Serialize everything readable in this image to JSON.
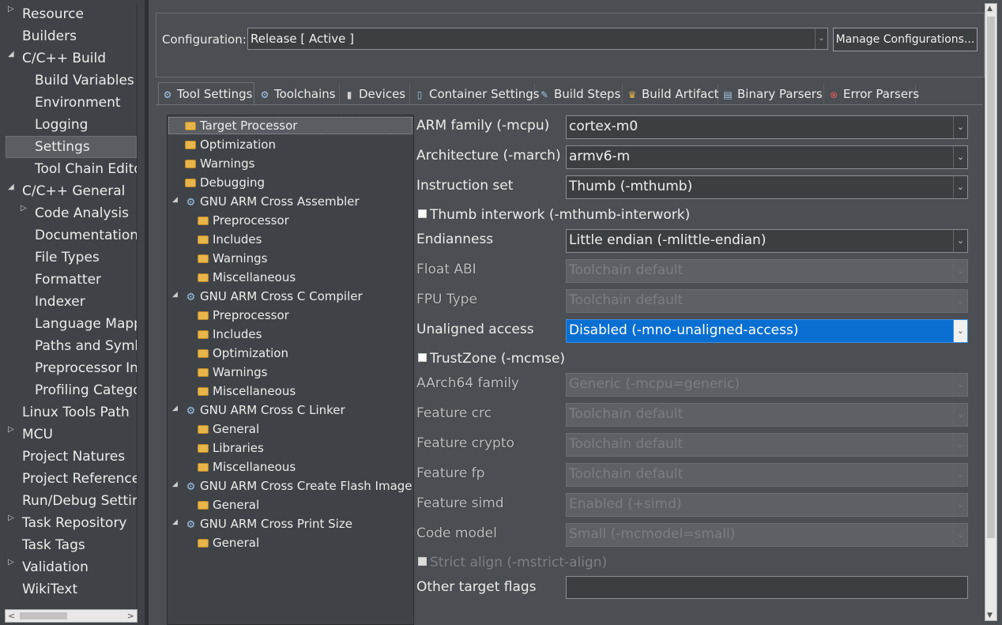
{
  "nav": {
    "items": [
      {
        "label": "Resource",
        "level": 0,
        "twisty": "closed"
      },
      {
        "label": "Builders",
        "level": 0,
        "twisty": "none"
      },
      {
        "label": "C/C++ Build",
        "level": 0,
        "twisty": "open"
      },
      {
        "label": "Build Variables",
        "level": 1,
        "twisty": "none"
      },
      {
        "label": "Environment",
        "level": 1,
        "twisty": "none"
      },
      {
        "label": "Logging",
        "level": 1,
        "twisty": "none"
      },
      {
        "label": "Settings",
        "level": 1,
        "twisty": "none",
        "selected": true
      },
      {
        "label": "Tool Chain Edito",
        "level": 1,
        "twisty": "none"
      },
      {
        "label": "C/C++ General",
        "level": 0,
        "twisty": "open"
      },
      {
        "label": "Code Analysis",
        "level": 1,
        "twisty": "closed"
      },
      {
        "label": "Documentation",
        "level": 1,
        "twisty": "none"
      },
      {
        "label": "File Types",
        "level": 1,
        "twisty": "none"
      },
      {
        "label": "Formatter",
        "level": 1,
        "twisty": "none"
      },
      {
        "label": "Indexer",
        "level": 1,
        "twisty": "none"
      },
      {
        "label": "Language Mapp",
        "level": 1,
        "twisty": "none"
      },
      {
        "label": "Paths and Symb",
        "level": 1,
        "twisty": "none"
      },
      {
        "label": "Preprocessor In",
        "level": 1,
        "twisty": "none"
      },
      {
        "label": "Profiling Catego",
        "level": 1,
        "twisty": "none"
      },
      {
        "label": "Linux Tools Path",
        "level": 0,
        "twisty": "none"
      },
      {
        "label": "MCU",
        "level": 0,
        "twisty": "closed"
      },
      {
        "label": "Project Natures",
        "level": 0,
        "twisty": "none"
      },
      {
        "label": "Project Reference",
        "level": 0,
        "twisty": "none"
      },
      {
        "label": "Run/Debug Settin",
        "level": 0,
        "twisty": "none"
      },
      {
        "label": "Task Repository",
        "level": 0,
        "twisty": "closed"
      },
      {
        "label": "Task Tags",
        "level": 0,
        "twisty": "none"
      },
      {
        "label": "Validation",
        "level": 0,
        "twisty": "closed"
      },
      {
        "label": "WikiText",
        "level": 0,
        "twisty": "none"
      }
    ]
  },
  "config": {
    "label": "Configuration:",
    "value": "Release  [ Active ]",
    "manage_label": "Manage Configurations..."
  },
  "tabs": [
    {
      "label": "Tool Settings",
      "icon": "tool-settings-icon",
      "glyph": "⚙",
      "active": true
    },
    {
      "label": "Toolchains",
      "icon": "toolchains-icon",
      "glyph": "⚙"
    },
    {
      "label": "Devices",
      "icon": "devices-icon",
      "glyph": "▮"
    },
    {
      "label": "Container Settings",
      "icon": "container-icon",
      "glyph": "▯"
    },
    {
      "label": "Build Steps",
      "icon": "build-steps-icon",
      "glyph": "✎"
    },
    {
      "label": "Build Artifact",
      "icon": "trophy-icon",
      "glyph": "♛"
    },
    {
      "label": "Binary Parsers",
      "icon": "binary-parsers-icon",
      "glyph": "▤"
    },
    {
      "label": "Error Parsers",
      "icon": "error-parsers-icon",
      "glyph": "⊗"
    }
  ],
  "tool_tree": [
    {
      "label": "Target Processor",
      "type": "folder",
      "level": 0,
      "selected": true
    },
    {
      "label": "Optimization",
      "type": "folder",
      "level": 0
    },
    {
      "label": "Warnings",
      "type": "folder",
      "level": 0
    },
    {
      "label": "Debugging",
      "type": "folder",
      "level": 0
    },
    {
      "label": "GNU ARM Cross Assembler",
      "type": "tool",
      "level": 0,
      "expanded": true
    },
    {
      "label": "Preprocessor",
      "type": "folder",
      "level": 1
    },
    {
      "label": "Includes",
      "type": "folder",
      "level": 1
    },
    {
      "label": "Warnings",
      "type": "folder",
      "level": 1
    },
    {
      "label": "Miscellaneous",
      "type": "folder",
      "level": 1
    },
    {
      "label": "GNU ARM Cross C Compiler",
      "type": "tool",
      "level": 0,
      "expanded": true
    },
    {
      "label": "Preprocessor",
      "type": "folder",
      "level": 1
    },
    {
      "label": "Includes",
      "type": "folder",
      "level": 1
    },
    {
      "label": "Optimization",
      "type": "folder",
      "level": 1
    },
    {
      "label": "Warnings",
      "type": "folder",
      "level": 1
    },
    {
      "label": "Miscellaneous",
      "type": "folder",
      "level": 1
    },
    {
      "label": "GNU ARM Cross C Linker",
      "type": "tool",
      "level": 0,
      "expanded": true
    },
    {
      "label": "General",
      "type": "folder",
      "level": 1
    },
    {
      "label": "Libraries",
      "type": "folder",
      "level": 1
    },
    {
      "label": "Miscellaneous",
      "type": "folder",
      "level": 1
    },
    {
      "label": "GNU ARM Cross Create Flash Image",
      "type": "tool",
      "level": 0,
      "expanded": true
    },
    {
      "label": "General",
      "type": "folder",
      "level": 1
    },
    {
      "label": "GNU ARM Cross Print Size",
      "type": "tool",
      "level": 0,
      "expanded": true
    },
    {
      "label": "General",
      "type": "folder",
      "level": 1
    }
  ],
  "settings": [
    {
      "kind": "combo",
      "label": "ARM family (-mcpu)",
      "value": "cortex-m0"
    },
    {
      "kind": "combo",
      "label": "Architecture (-march)",
      "value": "armv6-m"
    },
    {
      "kind": "combo",
      "label": "Instruction set",
      "value": "Thumb (-mthumb)"
    },
    {
      "kind": "check",
      "label": "Thumb interwork (-mthumb-interwork)",
      "checked": false
    },
    {
      "kind": "combo",
      "label": "Endianness",
      "value": "Little endian (-mlittle-endian)"
    },
    {
      "kind": "combo",
      "label": "Float ABI",
      "value": "Toolchain default",
      "disabled": true
    },
    {
      "kind": "combo",
      "label": "FPU Type",
      "value": "Toolchain default",
      "disabled": true
    },
    {
      "kind": "combo",
      "label": "Unaligned access",
      "value": "Disabled (-mno-unaligned-access)",
      "focused": true
    },
    {
      "kind": "check",
      "label": "TrustZone (-mcmse)",
      "checked": false
    },
    {
      "kind": "combo",
      "label": "AArch64 family",
      "value": "Generic (-mcpu=generic)",
      "disabled": true
    },
    {
      "kind": "combo",
      "label": "Feature crc",
      "value": "Toolchain default",
      "disabled": true
    },
    {
      "kind": "combo",
      "label": "Feature crypto",
      "value": "Toolchain default",
      "disabled": true
    },
    {
      "kind": "combo",
      "label": "Feature fp",
      "value": "Toolchain default",
      "disabled": true
    },
    {
      "kind": "combo",
      "label": "Feature simd",
      "value": "Enabled (+simd)",
      "disabled": true
    },
    {
      "kind": "combo",
      "label": "Code model",
      "value": "Small (-mcmodel=small)",
      "disabled": true
    },
    {
      "kind": "check",
      "label": "Strict align (-mstrict-align)",
      "checked": false,
      "disabled": true
    },
    {
      "kind": "text",
      "label": "Other target flags",
      "value": ""
    }
  ]
}
